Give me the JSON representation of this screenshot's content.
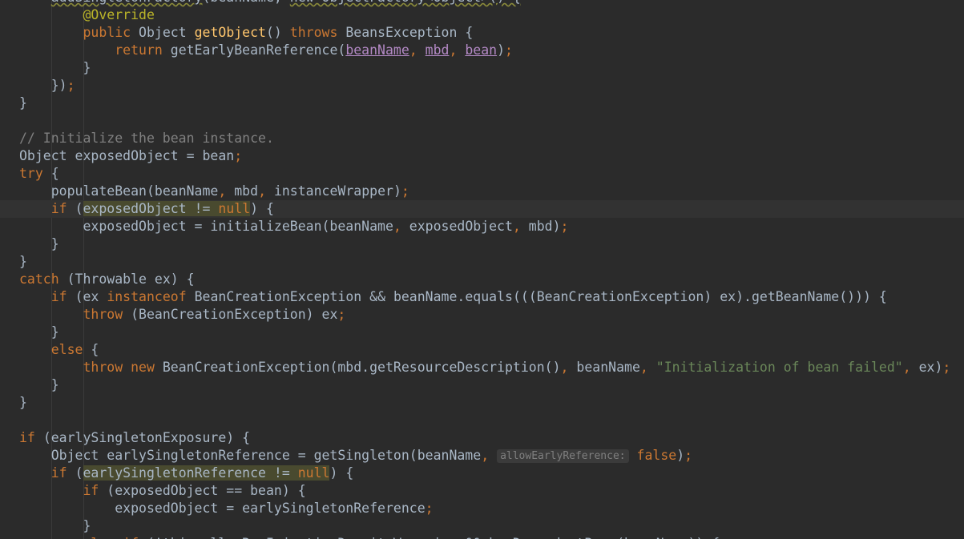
{
  "editor": {
    "lines": [
      {
        "indent": "        ",
        "tokens": [
          {
            "t": "addSingletonFactory",
            "c": "squig"
          },
          {
            "t": "(beanName, "
          },
          {
            "t": "new ObjectFactory<Object>() {",
            "c": "squig"
          }
        ]
      },
      {
        "indent": "            ",
        "tokens": [
          {
            "t": "@Override",
            "c": "ann"
          }
        ]
      },
      {
        "indent": "            ",
        "tokens": [
          {
            "t": "public ",
            "c": "kw"
          },
          {
            "t": "Object "
          },
          {
            "t": "getObject",
            "c": "fn"
          },
          {
            "t": "() "
          },
          {
            "t": "throws ",
            "c": "kw"
          },
          {
            "t": "BeansException {"
          }
        ]
      },
      {
        "indent": "                ",
        "tokens": [
          {
            "t": "return ",
            "c": "kw"
          },
          {
            "t": "getEarlyBeanReference("
          },
          {
            "t": "beanName",
            "c": "param"
          },
          {
            "t": ", ",
            "c": "kw"
          },
          {
            "t": "mbd",
            "c": "param"
          },
          {
            "t": ", ",
            "c": "kw"
          },
          {
            "t": "bean",
            "c": "param"
          },
          {
            "t": ")"
          },
          {
            "t": ";",
            "c": "kw"
          }
        ]
      },
      {
        "indent": "            ",
        "tokens": [
          {
            "t": "}"
          }
        ]
      },
      {
        "indent": "        ",
        "tokens": [
          {
            "t": "})"
          },
          {
            "t": ";",
            "c": "kw"
          }
        ]
      },
      {
        "indent": "    ",
        "tokens": [
          {
            "t": "}"
          }
        ]
      },
      {
        "indent": "",
        "tokens": []
      },
      {
        "indent": "    ",
        "tokens": [
          {
            "t": "// Initialize the bean instance.",
            "c": "cm"
          }
        ]
      },
      {
        "indent": "    ",
        "tokens": [
          {
            "t": "Object exposedObject = bean"
          },
          {
            "t": ";",
            "c": "kw"
          }
        ]
      },
      {
        "indent": "    ",
        "tokens": [
          {
            "t": "try ",
            "c": "kw"
          },
          {
            "t": "{"
          }
        ]
      },
      {
        "indent": "        ",
        "tokens": [
          {
            "t": "populateBean(beanName"
          },
          {
            "t": ", ",
            "c": "kw"
          },
          {
            "t": "mbd"
          },
          {
            "t": ", ",
            "c": "kw"
          },
          {
            "t": "instanceWrapper)"
          },
          {
            "t": ";",
            "c": "kw"
          }
        ]
      },
      {
        "indent": "        ",
        "current": true,
        "tokens": [
          {
            "t": "if ",
            "c": "kw"
          },
          {
            "t": "("
          },
          {
            "t": "exposedObject != ",
            "c": "hl"
          },
          {
            "t": "null",
            "c": "kw hl"
          },
          {
            "t": ") {"
          }
        ]
      },
      {
        "indent": "            ",
        "tokens": [
          {
            "t": "exposedObject = initializeBean(beanName"
          },
          {
            "t": ", ",
            "c": "kw"
          },
          {
            "t": "exposedObject"
          },
          {
            "t": ", ",
            "c": "kw"
          },
          {
            "t": "mbd)"
          },
          {
            "t": ";",
            "c": "kw"
          }
        ]
      },
      {
        "indent": "        ",
        "tokens": [
          {
            "t": "}"
          }
        ]
      },
      {
        "indent": "    ",
        "tokens": [
          {
            "t": "}"
          }
        ]
      },
      {
        "indent": "    ",
        "tokens": [
          {
            "t": "catch ",
            "c": "kw"
          },
          {
            "t": "(Throwable ex) {"
          }
        ]
      },
      {
        "indent": "        ",
        "tokens": [
          {
            "t": "if ",
            "c": "kw"
          },
          {
            "t": "(ex "
          },
          {
            "t": "instanceof ",
            "c": "kw"
          },
          {
            "t": "BeanCreationException && beanName.equals(((BeanCreationException) ex).getBeanName())) {"
          }
        ]
      },
      {
        "indent": "            ",
        "tokens": [
          {
            "t": "throw ",
            "c": "kw"
          },
          {
            "t": "(BeanCreationException) ex"
          },
          {
            "t": ";",
            "c": "kw"
          }
        ]
      },
      {
        "indent": "        ",
        "tokens": [
          {
            "t": "}"
          }
        ]
      },
      {
        "indent": "        ",
        "tokens": [
          {
            "t": "else ",
            "c": "kw"
          },
          {
            "t": "{"
          }
        ]
      },
      {
        "indent": "            ",
        "tokens": [
          {
            "t": "throw new ",
            "c": "kw"
          },
          {
            "t": "BeanCreationException(mbd.getResourceDescription()"
          },
          {
            "t": ", ",
            "c": "kw"
          },
          {
            "t": "beanName"
          },
          {
            "t": ", ",
            "c": "kw"
          },
          {
            "t": "\"Initialization of bean failed\"",
            "c": "str"
          },
          {
            "t": ", ",
            "c": "kw"
          },
          {
            "t": "ex)"
          },
          {
            "t": ";",
            "c": "kw"
          }
        ]
      },
      {
        "indent": "        ",
        "tokens": [
          {
            "t": "}"
          }
        ]
      },
      {
        "indent": "    ",
        "tokens": [
          {
            "t": "}"
          }
        ]
      },
      {
        "indent": "",
        "tokens": []
      },
      {
        "indent": "    ",
        "tokens": [
          {
            "t": "if ",
            "c": "kw"
          },
          {
            "t": "(earlySingletonExposure) {"
          }
        ]
      },
      {
        "indent": "        ",
        "tokens": [
          {
            "t": "Object earlySingletonReference = getSingleton(beanName"
          },
          {
            "t": ", ",
            "c": "kw"
          },
          {
            "t": "allowEarlyReference:",
            "c": "hint"
          },
          {
            "t": " "
          },
          {
            "t": "false",
            "c": "kw"
          },
          {
            "t": ")"
          },
          {
            "t": ";",
            "c": "kw"
          }
        ]
      },
      {
        "indent": "        ",
        "tokens": [
          {
            "t": "if ",
            "c": "kw"
          },
          {
            "t": "("
          },
          {
            "t": "earlySingletonReference != ",
            "c": "hl"
          },
          {
            "t": "null",
            "c": "kw hl"
          },
          {
            "t": ") {"
          }
        ]
      },
      {
        "indent": "            ",
        "tokens": [
          {
            "t": "if ",
            "c": "kw"
          },
          {
            "t": "(exposedObject == bean) {"
          }
        ]
      },
      {
        "indent": "                ",
        "tokens": [
          {
            "t": "exposedObject = earlySingletonReference"
          },
          {
            "t": ";",
            "c": "kw"
          }
        ]
      },
      {
        "indent": "            ",
        "tokens": [
          {
            "t": "}"
          }
        ]
      },
      {
        "indent": "            ",
        "tokens": [
          {
            "t": "else if ",
            "c": "kw"
          },
          {
            "t": "(!this.allowRawInjectionDespiteWrapping && hasDependentBean(beanName)) {"
          }
        ]
      }
    ]
  }
}
